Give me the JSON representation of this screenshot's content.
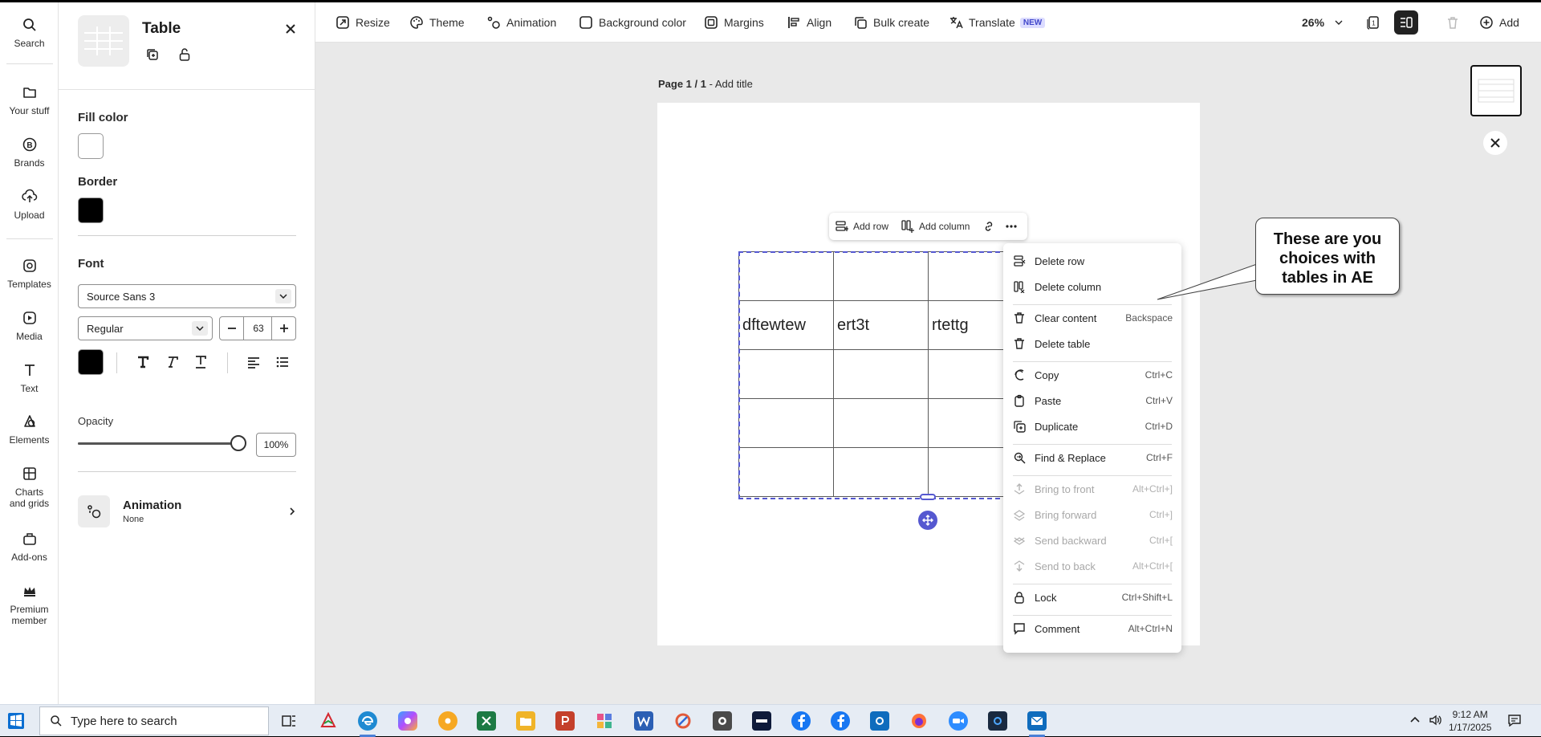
{
  "left_rail": {
    "items": [
      {
        "label": "Search",
        "icon": "search-icon"
      },
      {
        "label": "Your stuff",
        "icon": "folder-icon"
      },
      {
        "label": "Brands",
        "icon": "brand-icon"
      },
      {
        "label": "Upload",
        "icon": "upload-icon"
      },
      {
        "label": "Templates",
        "icon": "templates-icon"
      },
      {
        "label": "Media",
        "icon": "media-icon"
      },
      {
        "label": "Text",
        "icon": "text-icon"
      },
      {
        "label": "Elements",
        "icon": "elements-icon"
      },
      {
        "label": "Charts and grids",
        "icon": "charts-icon"
      },
      {
        "label": "Add-ons",
        "icon": "addons-icon"
      },
      {
        "label": "Premium member",
        "icon": "crown-icon"
      }
    ]
  },
  "panel": {
    "title": "Table",
    "fill_color": {
      "label": "Fill color",
      "value": "#ffffff"
    },
    "border": {
      "label": "Border",
      "value": "#000000"
    },
    "font": {
      "label": "Font",
      "family": "Source Sans 3",
      "weight": "Regular",
      "size": "63",
      "color": "#000000"
    },
    "opacity": {
      "label": "Opacity",
      "value": "100%",
      "level": 1.0
    },
    "animation": {
      "label": "Animation",
      "value": "None"
    }
  },
  "toolbar": {
    "items": [
      "Resize",
      "Theme",
      "Animation",
      "Background color",
      "Margins",
      "Align",
      "Bulk create",
      "Translate"
    ],
    "translate_badge": "NEW",
    "zoom": "26%",
    "page_count": "1",
    "add_label": "Add"
  },
  "canvas": {
    "page_label": "Page 1 / 1",
    "separator": " - ",
    "title_placeholder": "Add title"
  },
  "quick_toolbar": {
    "add_row": "Add row",
    "add_column": "Add column"
  },
  "table": {
    "rows": [
      [
        "",
        "",
        ""
      ],
      [
        "dftewtew",
        "ert3t",
        "rtettg"
      ],
      [
        "",
        "",
        ""
      ],
      [
        "",
        "",
        ""
      ],
      [
        "",
        "",
        ""
      ]
    ]
  },
  "context_menu": {
    "groups": [
      [
        {
          "label": "Delete row",
          "shortcut": "",
          "icon": "delete-row-icon",
          "disabled": false
        },
        {
          "label": "Delete column",
          "shortcut": "",
          "icon": "delete-column-icon",
          "disabled": false
        }
      ],
      [
        {
          "label": "Clear content",
          "shortcut": "Backspace",
          "icon": "trash-icon",
          "disabled": false
        },
        {
          "label": "Delete table",
          "shortcut": "",
          "icon": "trash-icon",
          "disabled": false
        }
      ],
      [
        {
          "label": "Copy",
          "shortcut": "Ctrl+C",
          "icon": "copy-icon",
          "disabled": false
        },
        {
          "label": "Paste",
          "shortcut": "Ctrl+V",
          "icon": "paste-icon",
          "disabled": false
        },
        {
          "label": "Duplicate",
          "shortcut": "Ctrl+D",
          "icon": "duplicate-icon",
          "disabled": false
        }
      ],
      [
        {
          "label": "Find & Replace",
          "shortcut": "Ctrl+F",
          "icon": "find-replace-icon",
          "disabled": false
        }
      ],
      [
        {
          "label": "Bring to front",
          "shortcut": "Alt+Ctrl+]",
          "icon": "bring-front-icon",
          "disabled": true
        },
        {
          "label": "Bring forward",
          "shortcut": "Ctrl+]",
          "icon": "bring-forward-icon",
          "disabled": true
        },
        {
          "label": "Send backward",
          "shortcut": "Ctrl+[",
          "icon": "send-backward-icon",
          "disabled": true
        },
        {
          "label": "Send to back",
          "shortcut": "Alt+Ctrl+[",
          "icon": "send-back-icon",
          "disabled": true
        }
      ],
      [
        {
          "label": "Lock",
          "shortcut": "Ctrl+Shift+L",
          "icon": "lock-icon",
          "disabled": false
        }
      ],
      [
        {
          "label": "Comment",
          "shortcut": "Alt+Ctrl+N",
          "icon": "comment-icon",
          "disabled": false
        }
      ]
    ]
  },
  "callout": {
    "text": "These  are you choices with tables in AE"
  },
  "taskbar": {
    "search_placeholder": "Type here to search",
    "time": "9:12 AM",
    "date": "1/17/2025"
  },
  "colors": {
    "accent": "#5558d0",
    "canvas_bg": "#e9e9e9"
  }
}
